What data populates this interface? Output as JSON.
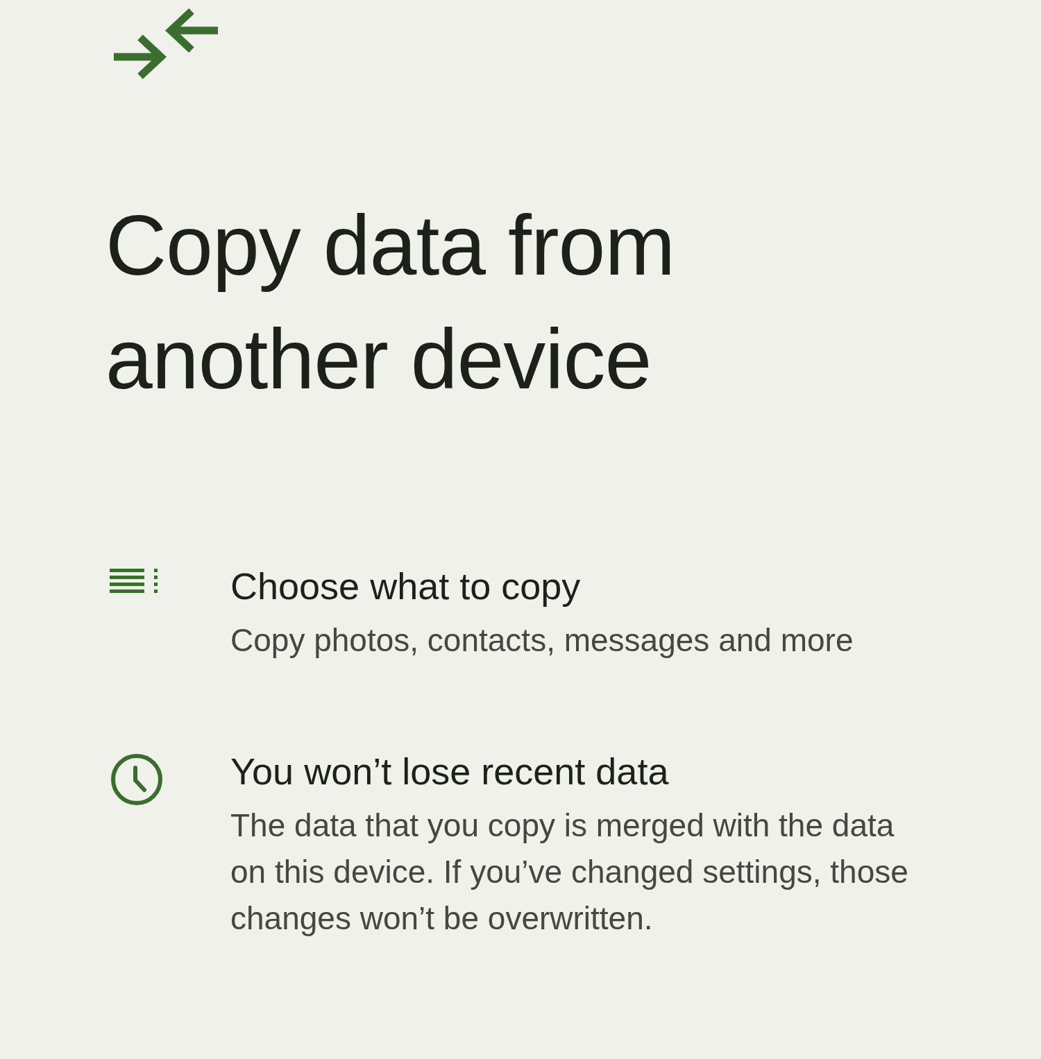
{
  "header": {
    "title": "Copy data from another device"
  },
  "features": [
    {
      "kind": "list",
      "title": "Choose what to copy",
      "description": "Copy photos, contacts, messages and more"
    },
    {
      "kind": "clock",
      "title": "You won’t lose recent data",
      "description": "The data that you copy is merged with the data on this device. If you’ve changed settings, those changes won’t be overwritten."
    }
  ]
}
